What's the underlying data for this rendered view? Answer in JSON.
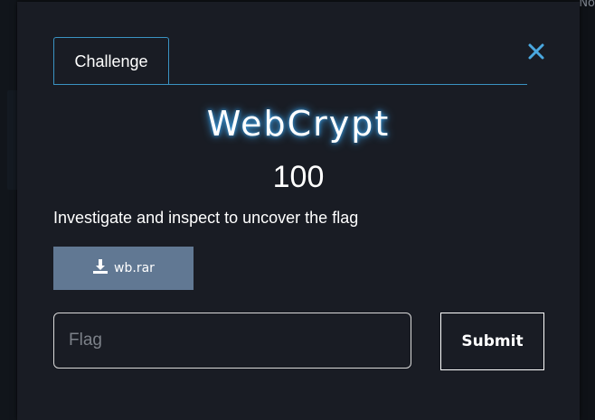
{
  "background": {
    "corner_text": "No"
  },
  "modal": {
    "tabs": [
      {
        "label": "Challenge"
      }
    ],
    "close_icon": "close-icon",
    "title": "WebCrypt",
    "value": "100",
    "description": "Investigate and inspect to uncover the flag",
    "file": {
      "icon": "download-icon",
      "label": "wb.rar"
    },
    "flag_input": {
      "placeholder": "Flag",
      "value": ""
    },
    "submit_label": "Submit"
  },
  "colors": {
    "modal_bg": "#191c24",
    "accent": "#3a93c3",
    "file_button": "#617893",
    "title_glow": "#44b3ff"
  }
}
